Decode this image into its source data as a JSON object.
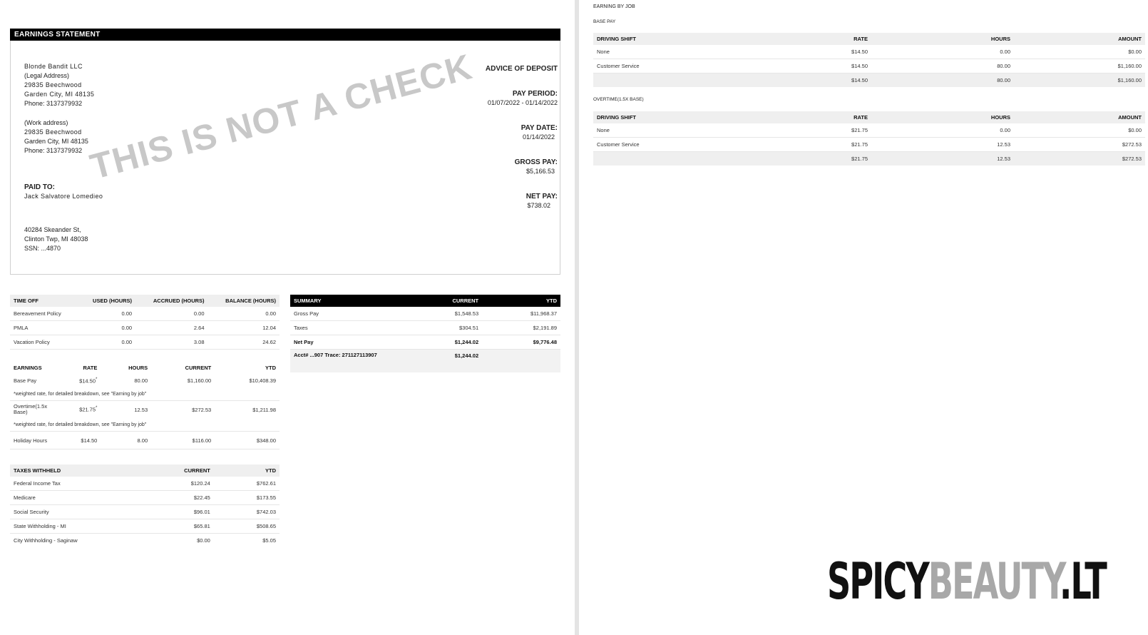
{
  "statement": {
    "header": "EARNINGS STATEMENT",
    "watermark": "THIS IS NOT A CHECK",
    "employer": {
      "name": "Blonde Bandit LLC",
      "legal_label": "(Legal Address)",
      "legal_street": "29835 Beechwood",
      "legal_city": "Garden City, MI 48135",
      "legal_phone": "Phone: 3137379932",
      "work_label": "(Work address)",
      "work_street": "29835 Beechwood",
      "work_city": "Garden City, MI 48135",
      "work_phone": "Phone: 3137379932"
    },
    "paid_to": {
      "label": "PAID TO:",
      "name": "Jack Salvatore Lomedieo",
      "street": "40284 Skeander St,",
      "city": "Clinton Twp, MI 48038",
      "ssn": "SSN: ...4870"
    },
    "deposit": {
      "advice": "ADVICE OF DEPOSIT",
      "period_label": "PAY PERIOD:",
      "period_value": "01/07/2022 - 01/14/2022",
      "date_label": "PAY DATE:",
      "date_value": "01/14/2022",
      "gross_label": "GROSS PAY:",
      "gross_value": "$5,166.53",
      "net_label": "NET PAY:",
      "net_value": "$738.02"
    }
  },
  "time_off": {
    "headers": [
      "TIME OFF",
      "USED (HOURS)",
      "ACCRUED (HOURS)",
      "BALANCE (HOURS)"
    ],
    "rows": [
      [
        "Bereavement Policy",
        "0.00",
        "0.00",
        "0.00"
      ],
      [
        "PMLA",
        "0.00",
        "2.64",
        "12.04"
      ],
      [
        "Vacation Policy",
        "0.00",
        "3.08",
        "24.62"
      ]
    ]
  },
  "summary": {
    "headers": [
      "SUMMARY",
      "CURRENT",
      "YTD"
    ],
    "rows": [
      [
        "Gross Pay",
        "$1,548.53",
        "$11,968.37"
      ],
      [
        "Taxes",
        "$304.51",
        "$2,191.89"
      ],
      [
        "Net Pay",
        "$1,244.02",
        "$9,776.48"
      ]
    ],
    "acct_label": "Acct# ...907 Trace: 271127113907",
    "acct_value": "$1,244.02"
  },
  "earnings": {
    "headers": [
      "EARNINGS",
      "RATE",
      "HOURS",
      "CURRENT",
      "YTD"
    ],
    "note": "*weighted rate, for detailed breakdown, see \"Earning by job\"",
    "base": [
      "Base Pay",
      "$14.50",
      "80.00",
      "$1,160.00",
      "$10,408.39"
    ],
    "overtime": [
      "Overtime(1.5x Base)",
      "$21.75",
      "12.53",
      "$272.53",
      "$1,211.98"
    ],
    "holiday": [
      "Holiday Hours",
      "$14.50",
      "8.00",
      "$116.00",
      "$348.00"
    ],
    "asterisk": "*"
  },
  "taxes": {
    "headers": [
      "TAXES WITHHELD",
      "CURRENT",
      "YTD"
    ],
    "rows": [
      [
        "Federal Income Tax",
        "$120.24",
        "$762.61"
      ],
      [
        "Medicare",
        "$22.45",
        "$173.55"
      ],
      [
        "Social Security",
        "$96.01",
        "$742.03"
      ],
      [
        "State Withholding - MI",
        "$65.81",
        "$508.65"
      ],
      [
        "City Withholding - Saginaw",
        "$0.00",
        "$5.05"
      ]
    ]
  },
  "earning_by_job": {
    "title": "EARNING BY JOB",
    "base": {
      "title": "BASE PAY",
      "headers": [
        "DRIVING SHIFT",
        "RATE",
        "HOURS",
        "AMOUNT"
      ],
      "rows": [
        [
          "None",
          "$14.50",
          "0.00",
          "$0.00"
        ],
        [
          "Customer Service",
          "$14.50",
          "80.00",
          "$1,160.00"
        ]
      ],
      "total": [
        "",
        "$14.50",
        "80.00",
        "$1,160.00"
      ]
    },
    "overtime": {
      "title": "OVERTIME(1.5X BASE)",
      "headers": [
        "DRIVING SHIFT",
        "RATE",
        "HOURS",
        "AMOUNT"
      ],
      "rows": [
        [
          "None",
          "$21.75",
          "0.00",
          "$0.00"
        ],
        [
          "Customer Service",
          "$21.75",
          "12.53",
          "$272.53"
        ]
      ],
      "total": [
        "",
        "$21.75",
        "12.53",
        "$272.53"
      ]
    }
  },
  "logo": {
    "part1": "SPICY",
    "part2": "BEAUTY",
    "part3": ".LT"
  }
}
